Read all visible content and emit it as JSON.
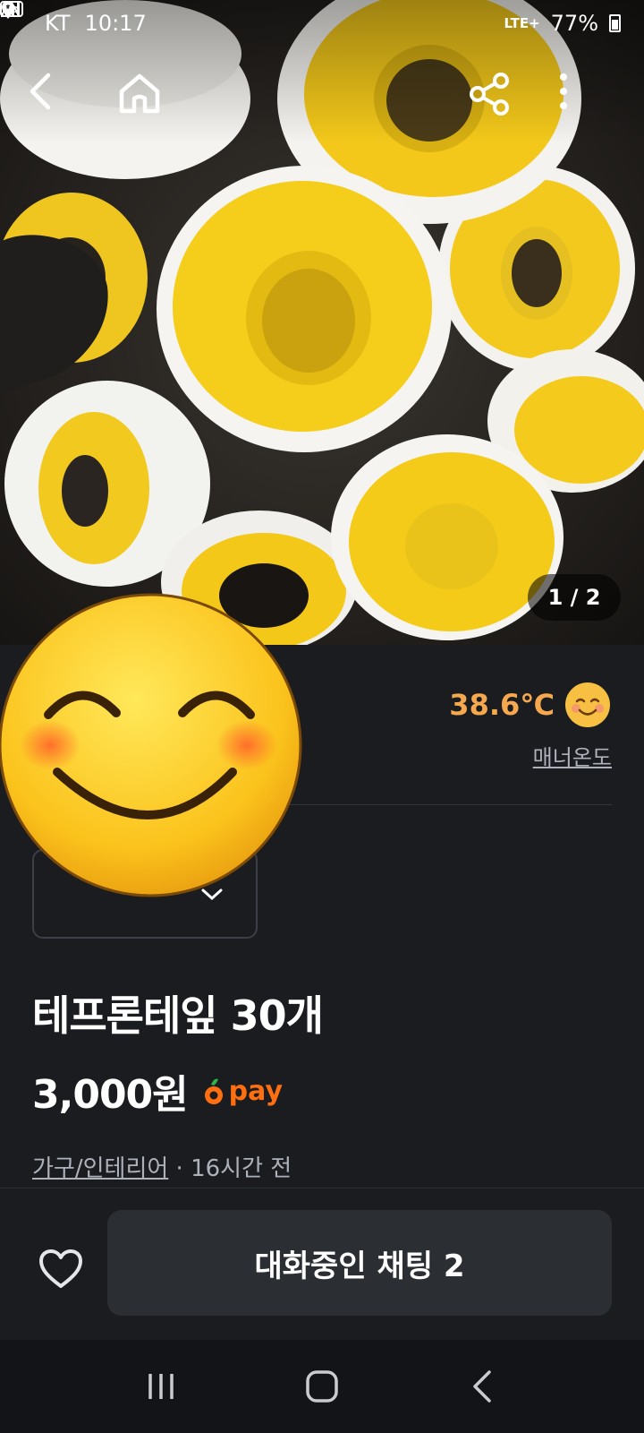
{
  "status_bar": {
    "carrier": "KT",
    "time": "10:17",
    "network": "LTE+",
    "battery": "77%"
  },
  "top_bar": {
    "back_icon": "chevron-left-icon",
    "home_icon": "home-icon",
    "share_icon": "share-icon",
    "more_icon": "more-vertical-icon"
  },
  "gallery": {
    "indicator": "1 / 2"
  },
  "seller": {
    "manner_temp": "38.6℃",
    "manner_label": "매너온도"
  },
  "product": {
    "title": "테프론테잎 30개",
    "price": "3,000원",
    "pay_label": "pay",
    "category": "가구/인테리어",
    "separator": " · ",
    "posted": "16시간 전"
  },
  "actions": {
    "chat_label": "대화중인 채팅 2"
  },
  "colors": {
    "accent": "#ff6f0f",
    "temp": "#f6a84f",
    "background": "#1a1c20"
  }
}
